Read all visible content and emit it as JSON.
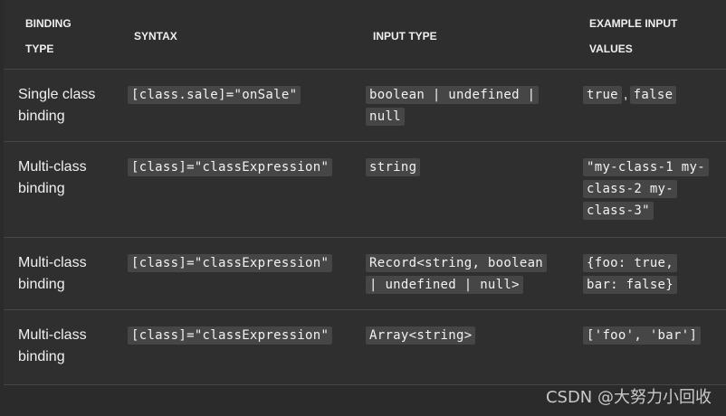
{
  "table": {
    "headers": {
      "binding_type": "BINDING\nTYPE",
      "syntax": "SYNTAX",
      "input_type": "INPUT TYPE",
      "example_values": "EXAMPLE INPUT\nVALUES"
    },
    "rows": [
      {
        "binding_type": "Single class\nbinding",
        "syntax": "[class.sale]=\"onSale\"",
        "input_type": [
          "boolean | undefined |",
          "null"
        ],
        "example_values": {
          "first": "true",
          "separator": ",",
          "second": "false"
        }
      },
      {
        "binding_type": "Multi-class\nbinding",
        "syntax": "[class]=\"classExpression\"",
        "input_type": [
          "string"
        ],
        "example_values": [
          "\"my-class-1 my-",
          "class-2 my-",
          "class-3\""
        ]
      },
      {
        "binding_type": "Multi-class\nbinding",
        "syntax": "[class]=\"classExpression\"",
        "input_type": [
          "Record<string, boolean",
          "| undefined | null>"
        ],
        "example_values": [
          "{foo: true,",
          "bar: false}"
        ]
      },
      {
        "binding_type": "Multi-class\nbinding",
        "syntax": "[class]=\"classExpression\"",
        "input_type": [
          "Array<string>"
        ],
        "example_values": [
          "['foo', 'bar']"
        ]
      }
    ]
  },
  "watermark": "CSDN @大努力小回收"
}
